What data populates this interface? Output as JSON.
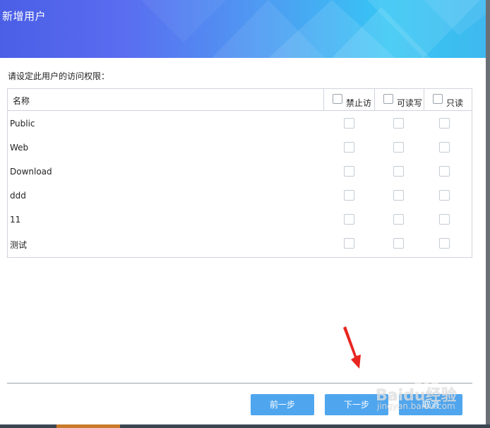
{
  "dialog": {
    "title": "新增用户",
    "prompt": "请设定此用户的访问权限："
  },
  "table": {
    "name_header": "名称",
    "columns": [
      {
        "label": "禁止访",
        "checked": false
      },
      {
        "label": "可读写",
        "checked": false
      },
      {
        "label": "只读",
        "checked": false
      }
    ],
    "rows": [
      {
        "name": "Public",
        "deny": false,
        "readwrite": false,
        "readonly": false
      },
      {
        "name": "Web",
        "deny": false,
        "readwrite": false,
        "readonly": false
      },
      {
        "name": "Download",
        "deny": false,
        "readwrite": false,
        "readonly": false
      },
      {
        "name": "ddd",
        "deny": false,
        "readwrite": false,
        "readonly": false
      },
      {
        "name": "11",
        "deny": false,
        "readwrite": false,
        "readonly": false
      },
      {
        "name": "测试",
        "deny": false,
        "readwrite": false,
        "readonly": false
      }
    ]
  },
  "footer": {
    "prev_label": "前一步",
    "next_label": "下一步",
    "cancel_label": "取消"
  },
  "annotation": {
    "arrow_color": "#e8251f"
  },
  "watermark": {
    "text": "Baidu经验",
    "subtext": "jingyan.baidu.com"
  },
  "colors": {
    "header_start": "#4a5fe6",
    "header_end": "#36c6f4",
    "button": "#4fa6ef"
  }
}
